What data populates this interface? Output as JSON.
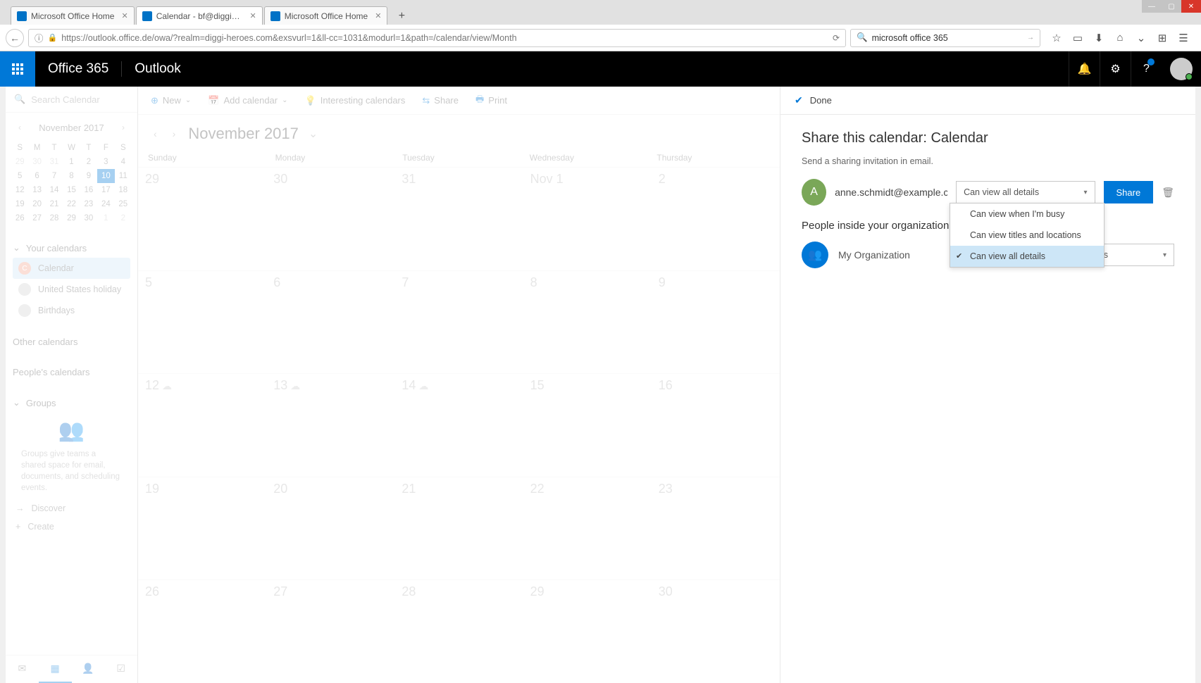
{
  "browser": {
    "tabs": [
      {
        "title": "Microsoft Office Home"
      },
      {
        "title": "Calendar - bf@diggi-heroes"
      },
      {
        "title": "Microsoft Office Home"
      }
    ],
    "url": "https://outlook.office.de/owa/?realm=diggi-heroes.com&exsvurl=1&ll-cc=1031&modurl=1&path=/calendar/view/Month",
    "search": "microsoft office 365"
  },
  "header": {
    "suite": "Office 365",
    "app": "Outlook"
  },
  "left": {
    "search_placeholder": "Search Calendar",
    "monthLabel": "November 2017",
    "mini_days": [
      "S",
      "M",
      "T",
      "W",
      "T",
      "F",
      "S"
    ],
    "mini_weeks": [
      [
        "29",
        "30",
        "31",
        "1",
        "2",
        "3",
        "4"
      ],
      [
        "5",
        "6",
        "7",
        "8",
        "9",
        "10",
        "11"
      ],
      [
        "12",
        "13",
        "14",
        "15",
        "16",
        "17",
        "18"
      ],
      [
        "19",
        "20",
        "21",
        "22",
        "23",
        "24",
        "25"
      ],
      [
        "26",
        "27",
        "28",
        "29",
        "30",
        "1",
        "2"
      ]
    ],
    "mini_today": "10",
    "mini_other_month": [
      "29",
      "30",
      "31",
      "1",
      "2"
    ],
    "section_your": "Your calendars",
    "cal_calendar": "Calendar",
    "cal_calendar_letter": "C",
    "cal_us": "United States holiday",
    "cal_bd": "Birthdays",
    "section_other": "Other calendars",
    "section_people": "People's calendars",
    "section_groups": "Groups",
    "groups_blurb": "Groups give teams a shared space for email, documents, and scheduling events.",
    "discover": "Discover",
    "create": "Create"
  },
  "toolbar": {
    "new": "New",
    "add": "Add calendar",
    "interesting": "Interesting calendars",
    "share": "Share",
    "print": "Print"
  },
  "center": {
    "month": "November 2017",
    "day_headers": [
      "Sunday",
      "Monday",
      "Tuesday",
      "Wednesday",
      "Thursday"
    ],
    "weeks": [
      [
        "29",
        "30",
        "31",
        "Nov 1",
        "2"
      ],
      [
        "5",
        "6",
        "7",
        "8",
        "9"
      ],
      [
        "12",
        "13",
        "14",
        "15",
        "16"
      ],
      [
        "19",
        "20",
        "21",
        "22",
        "23"
      ],
      [
        "26",
        "27",
        "28",
        "29",
        "30"
      ]
    ]
  },
  "share": {
    "done": "Done",
    "title": "Share this calendar: Calendar",
    "subtitle": "Send a sharing invitation in email.",
    "recipient_initial": "A",
    "recipient_email": "anne.schmidt@example.c",
    "perm_selected": "Can view all details",
    "perm_options": [
      "Can view when I'm busy",
      "Can view titles and locations",
      "Can view all details"
    ],
    "share_btn": "Share",
    "org_head": "People inside your organization",
    "org_name": "My Organization",
    "org_perm": "Can view all details"
  }
}
